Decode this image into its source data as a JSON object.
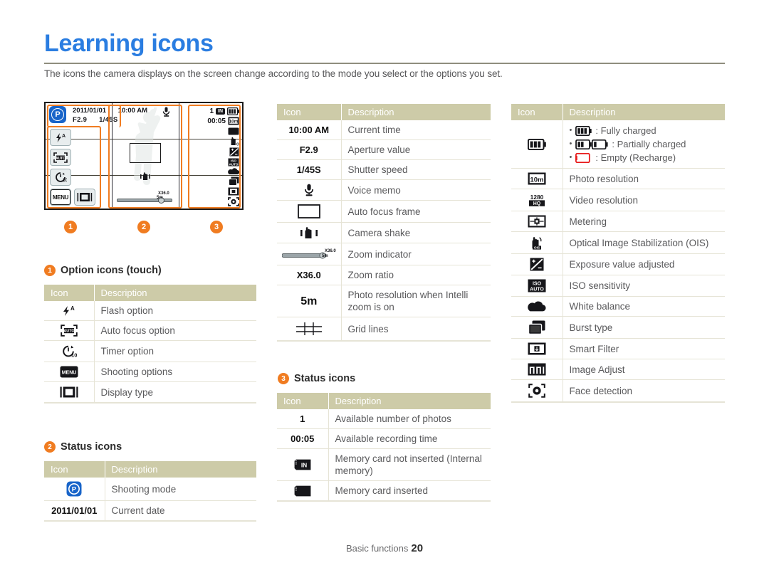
{
  "header": {
    "title": "Learning icons",
    "subtitle": "The icons the camera displays on the screen change according to the mode you select or the options you set."
  },
  "camera_preview": {
    "date": "2011/01/01",
    "time": "10:00 AM",
    "aperture": "F2.9",
    "shutter": "1/45S",
    "mode_letter": "P",
    "photos_remaining": "1",
    "memory_badge": "IN",
    "recording_time": "00:05",
    "zoom_ratio_label": "X36.0",
    "menu_label": "MENU",
    "markers": [
      "1",
      "2",
      "3"
    ]
  },
  "table_headers": {
    "icon": "Icon",
    "description": "Description"
  },
  "sections": {
    "option_icons_touch": {
      "number": "1",
      "label": "Option icons (touch)",
      "rows": [
        {
          "icon": "flash-auto-icon",
          "icon_text": "",
          "description": "Flash option"
        },
        {
          "icon": "auto-focus-icon",
          "icon_text": "",
          "description": "Auto focus option"
        },
        {
          "icon": "timer-icon",
          "icon_text": "",
          "description": "Timer option"
        },
        {
          "icon": "menu-icon",
          "icon_text": "MENU",
          "description": "Shooting options"
        },
        {
          "icon": "display-type-icon",
          "icon_text": "",
          "description": "Display type"
        }
      ]
    },
    "status_icons_left": {
      "number": "2",
      "label": "Status icons",
      "rows": [
        {
          "icon": "shooting-mode-icon",
          "icon_text": "P",
          "description": "Shooting mode"
        },
        {
          "icon": "date-text",
          "icon_text": "2011/01/01",
          "description": "Current date"
        }
      ]
    },
    "middle_icons": {
      "rows": [
        {
          "icon": "time-text",
          "icon_text": "10:00 AM",
          "description": "Current time"
        },
        {
          "icon": "aperture-text",
          "icon_text": "F2.9",
          "description": "Aperture value"
        },
        {
          "icon": "shutter-text",
          "icon_text": "1/45S",
          "description": "Shutter speed"
        },
        {
          "icon": "microphone-icon",
          "icon_text": "",
          "description": "Voice memo"
        },
        {
          "icon": "auto-focus-frame-icon",
          "icon_text": "",
          "description": "Auto focus frame"
        },
        {
          "icon": "camera-shake-icon",
          "icon_text": "",
          "description": "Camera shake"
        },
        {
          "icon": "zoom-indicator-icon",
          "icon_text": "",
          "description": "Zoom indicator"
        },
        {
          "icon": "zoom-ratio-text",
          "icon_text": "X36.0",
          "description": "Zoom ratio"
        },
        {
          "icon": "intelli-zoom-resolution-icon",
          "icon_text": "5m",
          "description": "Photo resolution when Intelli zoom is on"
        },
        {
          "icon": "grid-lines-icon",
          "icon_text": "",
          "description": "Grid lines"
        }
      ]
    },
    "status_icons_middle": {
      "number": "3",
      "label": "Status icons",
      "rows": [
        {
          "icon": "number-text",
          "icon_text": "1",
          "description": "Available number of photos"
        },
        {
          "icon": "recording-time-text",
          "icon_text": "00:05",
          "description": "Available recording time"
        },
        {
          "icon": "internal-memory-icon",
          "icon_text": "IN",
          "description": "Memory card not inserted (Internal memory)"
        },
        {
          "icon": "memory-card-icon",
          "icon_text": "",
          "description": "Memory card inserted"
        }
      ]
    },
    "status_icons_right": {
      "rows": [
        {
          "icon": "battery-icon",
          "icon_text": "",
          "description": "",
          "battery_states": [
            {
              "state_icon": "battery-full-icon",
              "label": ": Fully charged"
            },
            {
              "state_icon": "battery-partial-icon",
              "label": ": Partially charged"
            },
            {
              "state_icon": "battery-empty-icon",
              "label": ": Empty (Recharge)"
            }
          ]
        },
        {
          "icon": "photo-resolution-icon",
          "icon_text": "10m",
          "description": "Photo resolution"
        },
        {
          "icon": "video-resolution-icon",
          "icon_text": "1280 HQ",
          "description": "Video resolution"
        },
        {
          "icon": "metering-icon",
          "icon_text": "",
          "description": "Metering"
        },
        {
          "icon": "ois-icon",
          "icon_text": "OIS",
          "description": "Optical Image Stabilization (OIS)"
        },
        {
          "icon": "exposure-value-icon",
          "icon_text": "",
          "description": "Exposure value adjusted"
        },
        {
          "icon": "iso-icon",
          "icon_text": "ISO",
          "description": "ISO sensitivity"
        },
        {
          "icon": "white-balance-icon",
          "icon_text": "",
          "description": "White balance"
        },
        {
          "icon": "burst-type-icon",
          "icon_text": "",
          "description": "Burst type"
        },
        {
          "icon": "smart-filter-icon",
          "icon_text": "",
          "description": "Smart Filter"
        },
        {
          "icon": "image-adjust-icon",
          "icon_text": "",
          "description": "Image Adjust"
        },
        {
          "icon": "face-detection-icon",
          "icon_text": "",
          "description": "Face detection"
        }
      ]
    }
  },
  "footer": {
    "section": "Basic functions",
    "page": "20"
  },
  "colors": {
    "title_blue": "#2a7de1",
    "accent_orange": "#f07c21",
    "table_header": "#cdcba8",
    "row_divider": "#e6e4d6",
    "body_text": "#5a5a5c"
  }
}
